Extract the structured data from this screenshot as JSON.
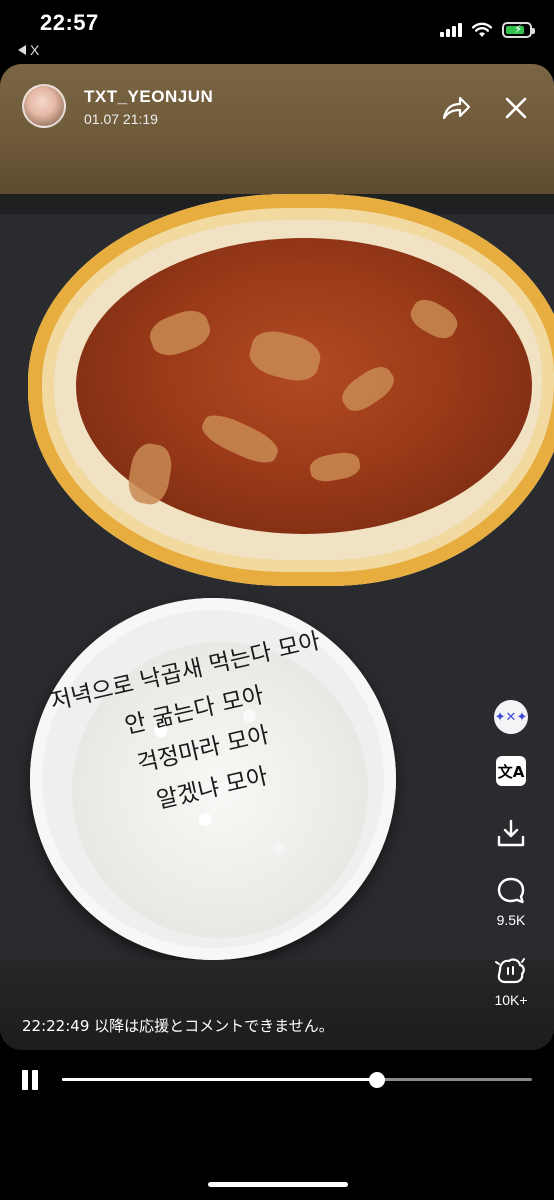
{
  "status_bar": {
    "time": "22:57",
    "back_label": "X"
  },
  "post": {
    "user_name": "TXT_YEONJUN",
    "timestamp": "01.07 21:19"
  },
  "photo_text": {
    "lines": [
      "저녁으로 낙곱새 먹는다 모아",
      "안 굶는다 모아",
      "걱정마라 모아",
      "알겠냐 모아"
    ]
  },
  "actions": {
    "sticker": "sticker-icon",
    "translate_glyph": "文A",
    "download": "download-icon",
    "comments_count": "9.5K",
    "cheer_count": "10K+"
  },
  "notice": "22:22:49 以降は応援とコメントできません。",
  "player": {
    "progress": 0.67
  },
  "colors": {
    "header_gradient_top": "#7a6543",
    "battery_green": "#31c24d",
    "background": "#000000"
  }
}
